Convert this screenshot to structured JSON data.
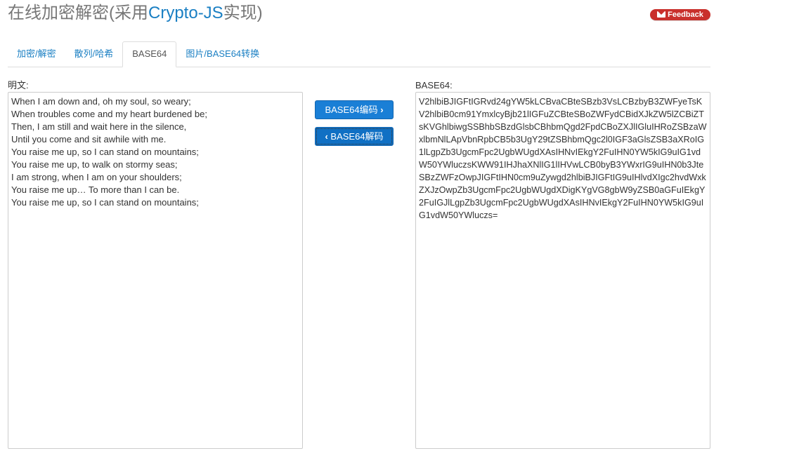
{
  "header": {
    "title_prefix": "在线加密解密(采用",
    "title_accent": "Crypto-JS",
    "title_suffix": "实现)",
    "feedback_label": "Feedback"
  },
  "tabs": [
    {
      "label": "加密/解密"
    },
    {
      "label": "散列/哈希"
    },
    {
      "label": "BASE64"
    },
    {
      "label": "图片/BASE64转换"
    }
  ],
  "plaintext": {
    "label": "明文:",
    "lines": [
      "When I am down and, oh my soul, so weary;",
      "When troubles come and my heart burdened be;",
      "Then, I am still and wait here in the silence,",
      "Until you come and sit awhile with me.",
      "You raise me up, so I can stand on mountains;",
      "You raise me up, to walk on stormy seas;",
      "I am strong, when I am on your shoulders;",
      "You raise me up… To more than I can be.",
      "You raise me up, so I can stand on mountains;"
    ]
  },
  "buttons": {
    "encode_label": "BASE64编码",
    "decode_label": "BASE64解码"
  },
  "base64": {
    "label": "BASE64:",
    "value": "V2hlbiBJIGFtIGRvd24gYW5kLCBvaCBteSBzb3VsLCBzbyB3ZWFyeTsKV2hlbiB0cm91YmxlcyBjb21lIGFuZCBteSBoZWFydCBidXJkZW5lZCBiZTsKVGhlbiwgSSBhbSBzdGlsbCBhbmQgd2FpdCBoZXJlIGluIHRoZSBzaWxlbmNlLApVbnRpbCB5b3UgY29tZSBhbmQgc2l0IGF3aGlsZSB3aXRoIG1lLgpZb3UgcmFpc2UgbWUgdXAsIHNvIEkgY2FuIHN0YW5kIG9uIG1vdW50YWluczsKWW91IHJhaXNlIG1lIHVwLCB0byB3YWxrIG9uIHN0b3JteSBzZWFzOwpJIGFtIHN0cm9uZywgd2hlbiBJIGFtIG9uIHlvdXIgc2hvdWxkZXJzOwpZb3UgcmFpc2UgbWUgdXDigKYgVG8gbW9yZSB0aGFuIEkgY2FuIGJlLgpZb3UgcmFpc2UgbWUgdXAsIHNvIEkgY2FuIHN0YW5kIG9uIG1vdW50YWluczs="
  }
}
